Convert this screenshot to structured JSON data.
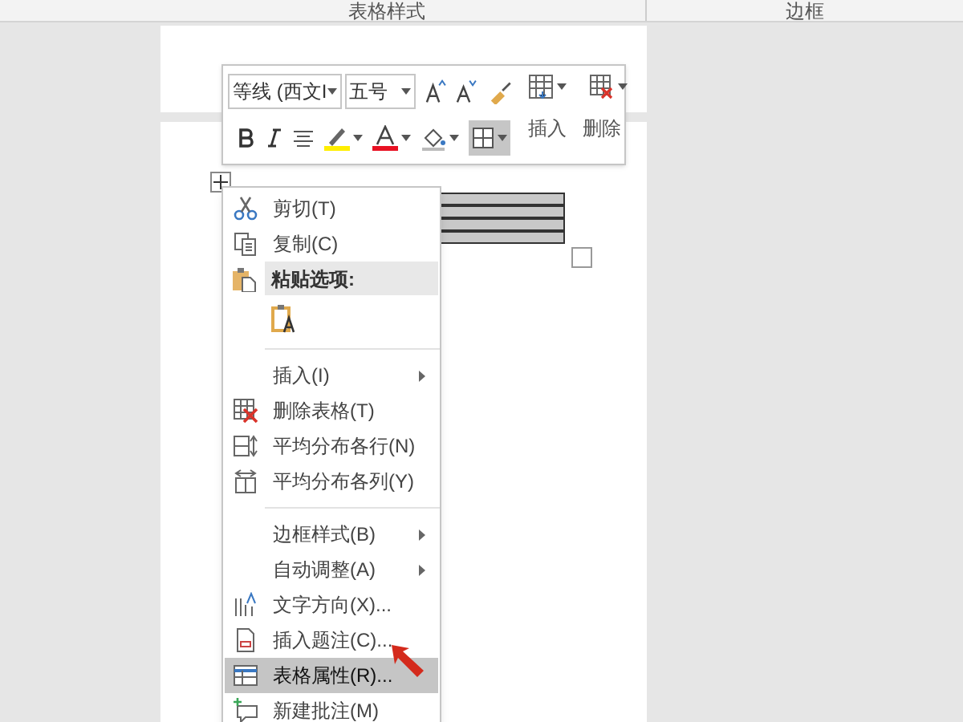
{
  "ribbon": {
    "groups": [
      "表格样式",
      "边框"
    ]
  },
  "mini_toolbar": {
    "font": {
      "value": "等线 (西文I"
    },
    "size": {
      "value": "五号"
    },
    "insert_label": "插入",
    "delete_label": "删除",
    "borders_selected": true
  },
  "menu": [
    {
      "kind": "item",
      "label": "剪切(T)",
      "submenu": false,
      "selected": false
    },
    {
      "kind": "item",
      "label": "复制(C)",
      "submenu": false,
      "selected": false
    },
    {
      "kind": "header",
      "label": "粘贴选项:"
    },
    {
      "kind": "paste-options"
    },
    {
      "kind": "separator"
    },
    {
      "kind": "item",
      "label": "插入(I)",
      "submenu": true,
      "selected": false
    },
    {
      "kind": "item",
      "label": "删除表格(T)",
      "submenu": false,
      "selected": false
    },
    {
      "kind": "item",
      "label": "平均分布各行(N)",
      "submenu": false,
      "selected": false
    },
    {
      "kind": "item",
      "label": "平均分布各列(Y)",
      "submenu": false,
      "selected": false
    },
    {
      "kind": "separator"
    },
    {
      "kind": "item",
      "label": "边框样式(B)",
      "submenu": true,
      "selected": false
    },
    {
      "kind": "item",
      "label": "自动调整(A)",
      "submenu": true,
      "selected": false
    },
    {
      "kind": "item",
      "label": "文字方向(X)...",
      "submenu": false,
      "selected": false
    },
    {
      "kind": "item",
      "label": "插入题注(C)...",
      "submenu": false,
      "selected": false
    },
    {
      "kind": "item",
      "label": "表格属性(R)...",
      "submenu": false,
      "selected": true
    },
    {
      "kind": "item",
      "label": "新建批注(M)",
      "submenu": false,
      "selected": false
    }
  ]
}
